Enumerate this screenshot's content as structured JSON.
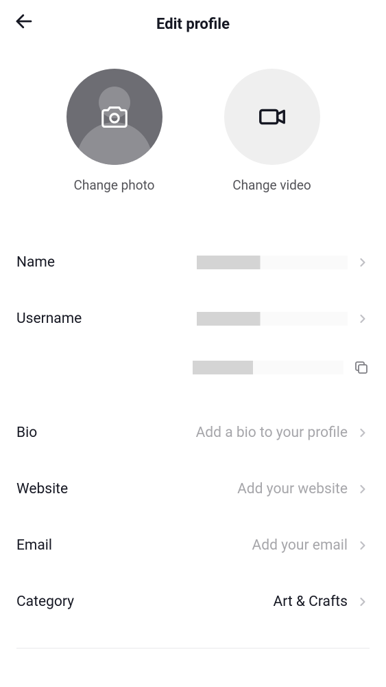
{
  "header": {
    "title": "Edit profile"
  },
  "media": {
    "photo_label": "Change photo",
    "video_label": "Change video"
  },
  "fields": {
    "name": {
      "label": "Name"
    },
    "username": {
      "label": "Username"
    },
    "bio": {
      "label": "Bio",
      "placeholder": "Add a bio to your profile"
    },
    "website": {
      "label": "Website",
      "placeholder": "Add your website"
    },
    "email": {
      "label": "Email",
      "placeholder": "Add your email"
    },
    "category": {
      "label": "Category",
      "value": "Art & Crafts"
    }
  }
}
